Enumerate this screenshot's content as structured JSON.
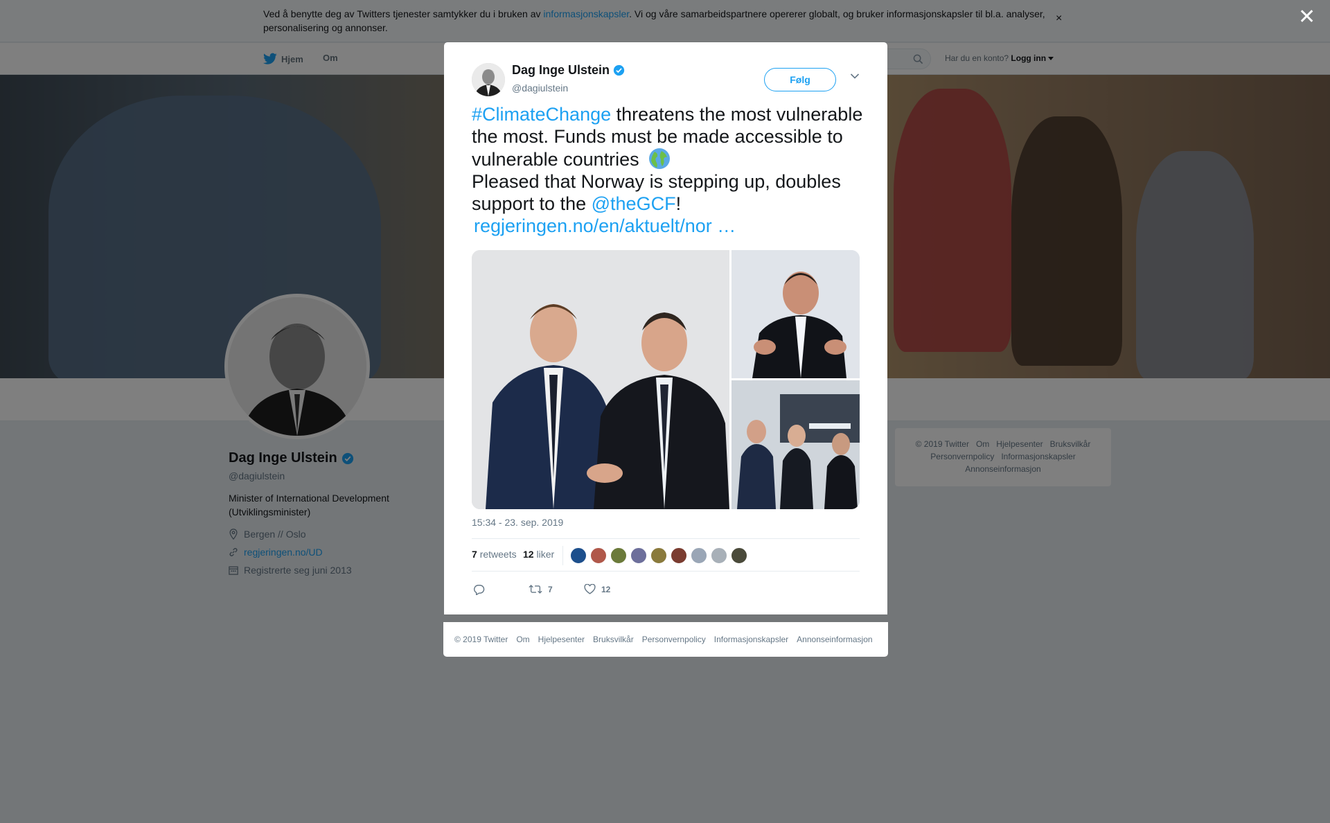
{
  "cookie_banner": {
    "text_before": "Ved å benytte deg av Twitters tjenester samtykker du i bruken av ",
    "link": "informasjonskapsler",
    "text_after": ". Vi og våre samarbeidspartnere opererer globalt, og bruker informasjonskapsler til bl.a. analyser, personalisering og annonser.",
    "close": "×"
  },
  "nav": {
    "home": "Hjem",
    "about": "Om",
    "account_prompt": "Har du en konto?",
    "login": "Logg inn"
  },
  "profile": {
    "name": "Dag Inge Ulstein",
    "handle": "@dagiulstein",
    "bio": "Minister of International Development (Utviklingsminister)",
    "location": "Bergen // Oslo",
    "website": "regjeringen.no/UD",
    "joined": "Registrerte seg juni 2013"
  },
  "side_footer": {
    "line1": [
      "© 2019 Twitter",
      "Om",
      "Hjelpesenter",
      "Bruksvilkår"
    ],
    "line2": [
      "Personvernpolicy",
      "Informasjonskapsler"
    ],
    "line3": [
      "Annonseinformasjon"
    ]
  },
  "overlay_close": "✕",
  "tweet": {
    "name": "Dag Inge Ulstein",
    "handle": "@dagiulstein",
    "follow": "Følg",
    "text": {
      "hashtag": "#ClimateChange",
      "part1": " threatens the most vulnerable the most. Funds must be made accessible to vulnerable countries ",
      "part2": "Pleased that Norway is stepping up, doubles support to the ",
      "mention": "@theGCF",
      "part3": "!",
      "link": "regjeringen.no/en/aktuelt/nor",
      "ellipsis": " …"
    },
    "timestamp": "15:34 - 23. sep. 2019",
    "retweets_count": "7",
    "retweets_label": "retweets",
    "likes_count": "12",
    "likes_label": "liker",
    "action_retweets": "7",
    "action_likes": "12",
    "liker_colors": [
      "#1d4f8c",
      "#b0584a",
      "#6b7a3a",
      "#6d6f9b",
      "#8a7a3c",
      "#7a3c30",
      "#9aa6b6",
      "#a8b0b8",
      "#4a4a3a"
    ]
  },
  "modal_footer": [
    "© 2019 Twitter",
    "Om",
    "Hjelpesenter",
    "Bruksvilkår",
    "Personvernpolicy",
    "Informasjonskapsler",
    "Annonseinformasjon"
  ],
  "colors": {
    "accent": "#1da1f2",
    "text": "#14171a",
    "muted": "#657786"
  }
}
